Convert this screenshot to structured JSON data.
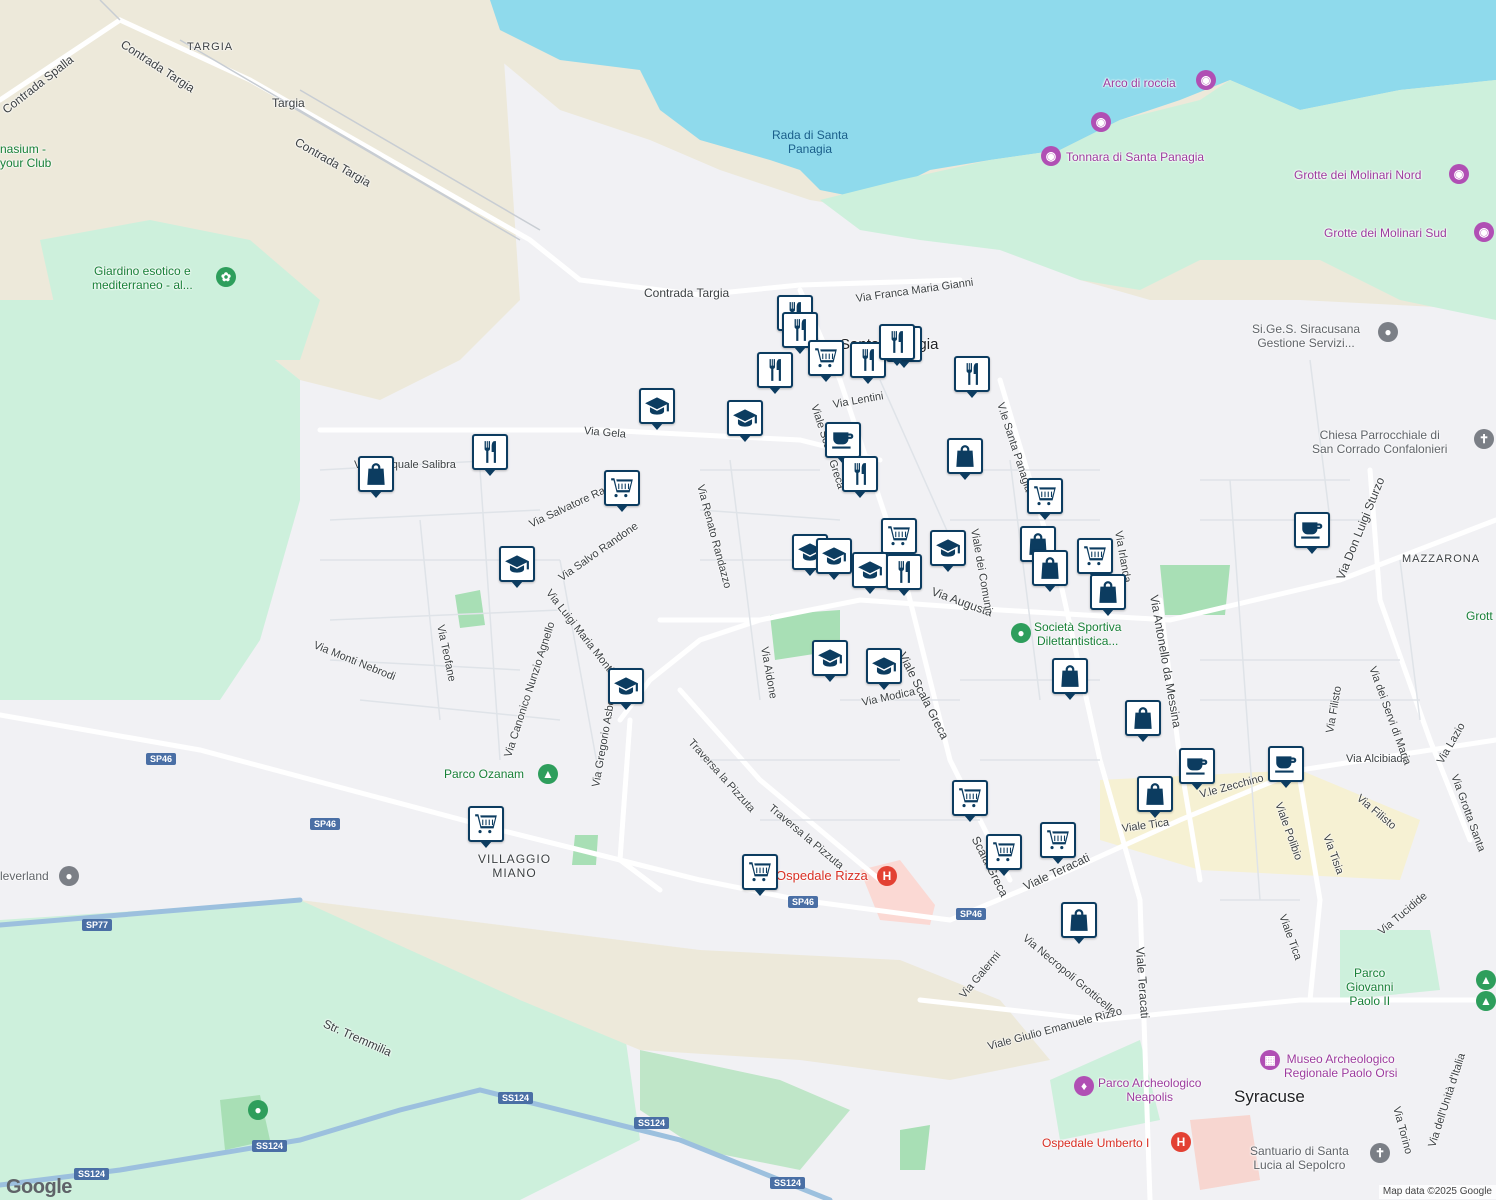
{
  "colors": {
    "water": "#8fdaec",
    "park": "#cdf0dc",
    "land_beige": "#ede9da",
    "urban": "#f1f1f4",
    "road": "#ffffff",
    "highway": "#8ab4d8",
    "marker_border": "#0c3c60",
    "poi_purple": "#b04fb4",
    "poi_green": "#2e9e5c",
    "poi_red": "#e34133",
    "poi_gray": "#7b7f86"
  },
  "labels": {
    "targia_district": "TARGIA",
    "targia_station": "Targia",
    "contrada_spalla": "Contrada Spalla",
    "contrada_targia_1": "Contrada Targia",
    "contrada_targia_2": "Contrada Targia",
    "gymnasium": "nasium -\nyour Club",
    "giardino": "Giardino esotico e\nmediterraneo - al...",
    "rada": "Rada di Santa\nPanagia",
    "arco": "Arco di roccia",
    "tonnara": "Tonnara di Santa Panagia",
    "grotte_nord": "Grotte dei Molinari Nord",
    "grotte_sud": "Grotte dei Molinari Sud",
    "sige": "Si.Ge.S. Siracusana\nGestione Servizi...",
    "chiesa": "Chiesa Parrocchiale di\nSan Corrado Confalonieri",
    "mazzarona": "MAZZARONA",
    "franca": "Via Franca Maria Gianni",
    "santa_panagia": "Santa Panagia",
    "via_lentini": "Via Lentini",
    "via_gela": "Via Gela",
    "pasquale": "Via Pasquale Salibra",
    "salvatore": "Via Salvatore Rao",
    "salvo": "Via Salvo Randone",
    "renato": "Via Renato Randazzo",
    "luigi": "Via Luigi Maria Monti",
    "canonico": "Via Canonico Nunzio Agnello",
    "teofane": "Via Teofane",
    "nebrodi": "Via Monti Nebrodi",
    "gregorio": "Via Gregorio Asbo",
    "aidone": "Via Aidone",
    "modica": "Via Modica",
    "scala_greca": "Viale Scala Greca",
    "scala_greca_2": "Scala Greca",
    "via_augusta": "Via Augusta",
    "santa_panagia_street": "V.le Santa Panagia",
    "comuni": "Viale dei Comuni",
    "irlanda": "Via Irlanda",
    "antonello": "Via Antonello da Messina",
    "don_luigi": "Via Don Luigi Sturzo",
    "societa": "Società Sportiva\nDilettantistica...",
    "pizzuta_1": "Traversa la Pizzuta",
    "pizzuta_2": "Traversa la Pizzuta",
    "parco_ozanam": "Parco Ozanam",
    "villaggio": "VILLAGGIO\nMIANO",
    "neverland": "leverland",
    "ospedale_rizza": "Ospedale Rizza",
    "viale_teracati_1": "Viale Teracati",
    "viale_teracati_2": "Viale Teracati",
    "viale_tica_1": "Viale Tica",
    "viale_tica_2": "Viale Tica",
    "necropoli": "Via Necropoli Grotticelle",
    "galermi": "Via Galermi",
    "giulio": "Viale Giulio Emanuele Rizzo",
    "zecchino": "V.le Zecchino",
    "filisto_1": "Via Filisto",
    "filisto_2": "Via Filisto",
    "alcibiade": "Via Alcibiade",
    "polibio": "Viale Polibio",
    "tisia": "Via Tisia",
    "servi": "Via dei Servi di Maria",
    "grotta": "Via Grotta Santa",
    "lazio": "Via Lazio",
    "tucidide": "Via Tucidide",
    "parco_giovanni": "Parco\nGiovanni\nPaolo II",
    "museo": "Museo Archeologico\nRegionale Paolo Orsi",
    "parco_archeo": "Parco Archeologico\nNeapolis",
    "syracuse": "Syracuse",
    "ospedale_umberto": "Ospedale Umberto I",
    "santuario": "Santuario di Santa\nLucia al Sepolcro",
    "str_tremmilia": "Str. Tremmilia",
    "torino": "Via Torino",
    "unita": "Via dell'Unità d'Italia",
    "grott_edge": "Grott"
  },
  "shields": {
    "sp46_a": "SP46",
    "sp46_b": "SP46",
    "sp46_c": "SP46",
    "sp46_d": "SP46",
    "sp77": "SP77",
    "ss124_a": "SS124",
    "ss124_b": "SS124",
    "ss124_c": "SS124",
    "ss124_d": "SS124",
    "ss124_e": "SS124"
  },
  "markers": [
    {
      "type": "restaurant"
    },
    {
      "type": "restaurant"
    },
    {
      "type": "grocery"
    },
    {
      "type": "restaurant"
    },
    {
      "type": "restaurant"
    },
    {
      "type": "restaurant"
    },
    {
      "type": "restaurant"
    },
    {
      "type": "restaurant"
    },
    {
      "type": "school"
    },
    {
      "type": "school"
    },
    {
      "type": "restaurant"
    },
    {
      "type": "shopping"
    },
    {
      "type": "grocery"
    },
    {
      "type": "school"
    },
    {
      "type": "cafe"
    },
    {
      "type": "restaurant"
    },
    {
      "type": "shopping"
    },
    {
      "type": "grocery"
    },
    {
      "type": "school"
    },
    {
      "type": "school"
    },
    {
      "type": "grocery"
    },
    {
      "type": "school"
    },
    {
      "type": "restaurant"
    },
    {
      "type": "school"
    },
    {
      "type": "shopping"
    },
    {
      "type": "shopping"
    },
    {
      "type": "grocery"
    },
    {
      "type": "shopping"
    },
    {
      "type": "cafe"
    },
    {
      "type": "school"
    },
    {
      "type": "school"
    },
    {
      "type": "shopping"
    },
    {
      "type": "school"
    },
    {
      "type": "shopping"
    },
    {
      "type": "cafe"
    },
    {
      "type": "cafe"
    },
    {
      "type": "shopping"
    },
    {
      "type": "grocery"
    },
    {
      "type": "grocery"
    },
    {
      "type": "grocery"
    },
    {
      "type": "grocery"
    },
    {
      "type": "grocery"
    },
    {
      "type": "shopping"
    }
  ],
  "attribution": "Map data ©2025 Google",
  "logo": "Google"
}
